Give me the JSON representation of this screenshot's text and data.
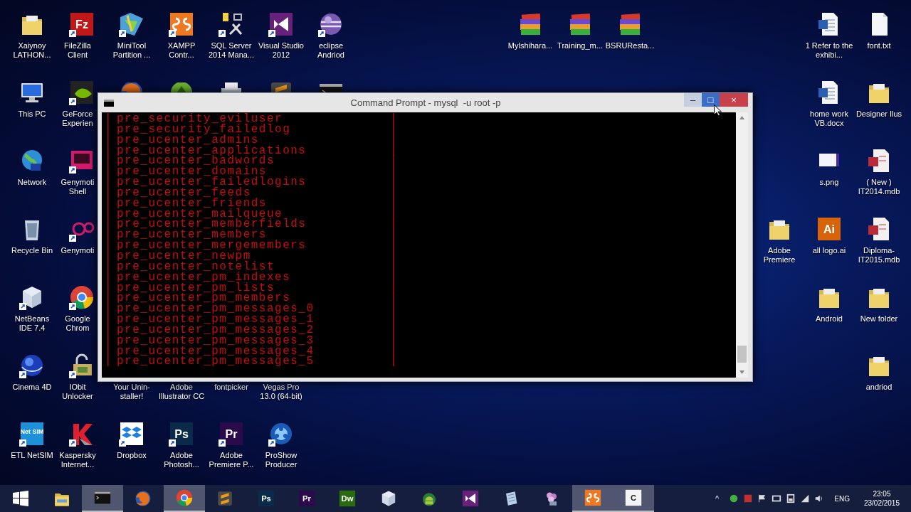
{
  "desktop": {
    "left_columns": [
      {
        "icons": [
          {
            "label": "Xaiynoy LATHON...",
            "kind": "folder",
            "shortcut": false
          },
          {
            "label": "This PC",
            "kind": "pc",
            "shortcut": false
          },
          {
            "label": "Network",
            "kind": "globe",
            "shortcut": false
          },
          {
            "label": "Recycle Bin",
            "kind": "bin",
            "shortcut": false
          },
          {
            "label": "NetBeans IDE 7.4",
            "kind": "cube",
            "shortcut": true
          },
          {
            "label": "Cinema 4D",
            "kind": "sphere",
            "shortcut": true
          },
          {
            "label": "ETL NetSIM",
            "kind": "tile",
            "glyph": "Net SIM",
            "color": "#1e90d8",
            "shortcut": true
          }
        ]
      },
      {
        "icons": [
          {
            "label": "FileZilla Client",
            "kind": "tile",
            "glyph": "Fz",
            "color": "#c01818",
            "shortcut": true
          },
          {
            "label": "GeForce Experien",
            "kind": "nvidia",
            "shortcut": true
          },
          {
            "label": "Genymoti Shell",
            "kind": "geny",
            "shortcut": true
          },
          {
            "label": "Genymoti",
            "kind": "geny2",
            "shortcut": true
          },
          {
            "label": "Google Chrom",
            "kind": "chrome",
            "shortcut": true
          },
          {
            "label": "IObit Unlocker",
            "kind": "lock",
            "shortcut": true
          },
          {
            "label": "Kaspersky Internet...",
            "kind": "kaspersky",
            "shortcut": true
          }
        ]
      }
    ],
    "upper_columns": [
      {
        "icons": [
          {
            "label": "MiniTool Partition ...",
            "kind": "minitool",
            "shortcut": true
          },
          {
            "kind": "firefox"
          }
        ]
      },
      {
        "icons": [
          {
            "label": "XAMPP Contr...",
            "kind": "xampp",
            "shortcut": true
          },
          {
            "kind": "greenball"
          }
        ]
      },
      {
        "icons": [
          {
            "label": "SQL Server 2014 Mana...",
            "kind": "sql",
            "shortcut": true
          },
          {
            "kind": "printer"
          }
        ]
      },
      {
        "icons": [
          {
            "label": "Visual Studio 2012",
            "kind": "vs",
            "shortcut": true
          },
          {
            "kind": "sublime"
          }
        ]
      },
      {
        "icons": [
          {
            "label": "eclipse Andriod",
            "kind": "eclipse",
            "shortcut": true
          },
          {
            "kind": "cmd"
          }
        ]
      }
    ],
    "lower_columns": [
      {
        "icons": [
          {
            "label": "Your Unin-staller!"
          },
          {
            "label": "Dropbox",
            "kind": "dropbox",
            "shortcut": true
          }
        ]
      },
      {
        "icons": [
          {
            "label": "Adobe Illustrator CC"
          },
          {
            "label": "Adobe Photosh...",
            "kind": "tile",
            "glyph": "Ps",
            "color": "#0a2a4a",
            "shortcut": true
          }
        ]
      },
      {
        "icons": [
          {
            "label": "fontpicker"
          },
          {
            "label": "Adobe Premiere P...",
            "kind": "tile",
            "glyph": "Pr",
            "color": "#2a0a4a",
            "shortcut": true
          }
        ]
      },
      {
        "icons": [
          {
            "label": "Vegas Pro 13.0 (64-bit)"
          },
          {
            "label": "ProShow Producer",
            "kind": "proshow",
            "shortcut": true
          }
        ]
      }
    ],
    "middle_columns": [
      {
        "icons": [
          {
            "label": "Mylshihara...",
            "kind": "rar",
            "shortcut": false
          }
        ]
      },
      {
        "icons": [
          {
            "label": "Training_m...",
            "kind": "rar",
            "shortcut": false
          }
        ]
      },
      {
        "icons": [
          {
            "label": "BSRUResta...",
            "kind": "rar",
            "shortcut": false
          }
        ]
      }
    ],
    "right_lone": [
      {
        "icons": [
          {
            "label": "Adobe Premiere",
            "kind": "folder",
            "shortcut": false
          }
        ]
      }
    ],
    "right_columns": [
      {
        "icons": [
          {
            "label": "1 Refer to the exhibi...",
            "kind": "word",
            "shortcut": false
          },
          {
            "label": "home work VB.docx",
            "kind": "word",
            "shortcut": false
          },
          {
            "label": "s.png",
            "kind": "image",
            "shortcut": false
          },
          {
            "label": "all logo.ai",
            "kind": "tile",
            "glyph": "Ai",
            "color": "#d8640a",
            "shortcut": false
          },
          {
            "label": "Android",
            "kind": "folder",
            "shortcut": false
          }
        ]
      },
      {
        "icons": [
          {
            "label": "font.txt",
            "kind": "doc",
            "shortcut": false
          },
          {
            "label": "Designer Ilus",
            "kind": "folder",
            "shortcut": false
          },
          {
            "label": "( New ) IT2014.mdb",
            "kind": "access",
            "shortcut": false
          },
          {
            "label": "Diploma-IT2015.mdb",
            "kind": "access",
            "shortcut": false
          },
          {
            "label": "New folder",
            "kind": "folder",
            "shortcut": false
          },
          {
            "label": "andriod",
            "kind": "folder",
            "shortcut": false
          }
        ]
      }
    ]
  },
  "window": {
    "title": "Command Prompt - mysql  -u root -p",
    "buttons": [
      {
        "kind": "minimize",
        "glyph": "–",
        "hovered": false
      },
      {
        "kind": "maximize",
        "glyph": "□",
        "hovered": true
      },
      {
        "kind": "close",
        "glyph": "×",
        "hovered": false
      }
    ],
    "console_rows": [
      {
        "left": "|",
        "name": "pre_security_eviluser",
        "right": "|"
      },
      {
        "left": "|",
        "name": "pre_security_failedlog",
        "right": "|"
      },
      {
        "left": "|",
        "name": "pre_ucenter_admins",
        "right": "|"
      },
      {
        "left": "|",
        "name": "pre_ucenter_applications",
        "right": "|"
      },
      {
        "left": "|",
        "name": "pre_ucenter_badwords",
        "right": "|"
      },
      {
        "left": "|",
        "name": "pre_ucenter_domains",
        "right": "|"
      },
      {
        "left": "|",
        "name": "pre_ucenter_failedlogins",
        "right": "|"
      },
      {
        "left": "|",
        "name": "pre_ucenter_feeds",
        "right": "|"
      },
      {
        "left": "|",
        "name": "pre_ucenter_friends",
        "right": "|"
      },
      {
        "left": "|",
        "name": "pre_ucenter_mailqueue",
        "right": "|"
      },
      {
        "left": "|",
        "name": "pre_ucenter_memberfields",
        "right": "|"
      },
      {
        "left": "|",
        "name": "pre_ucenter_members",
        "right": "|"
      },
      {
        "left": "|",
        "name": "pre_ucenter_mergemembers",
        "right": "|"
      },
      {
        "left": "|",
        "name": "pre_ucenter_newpm",
        "right": "|"
      },
      {
        "left": "|",
        "name": "pre_ucenter_notelist",
        "right": "|"
      },
      {
        "left": "|",
        "name": "pre_ucenter_pm_indexes",
        "right": "|"
      },
      {
        "left": "|",
        "name": "pre_ucenter_pm_lists",
        "right": "|"
      },
      {
        "left": "|",
        "name": "pre_ucenter_pm_members",
        "right": "|"
      },
      {
        "left": "|",
        "name": "pre_ucenter_pm_messages_0",
        "right": "|"
      },
      {
        "left": "|",
        "name": "pre_ucenter_pm_messages_1",
        "right": "|"
      },
      {
        "left": "|",
        "name": "pre_ucenter_pm_messages_2",
        "right": "|"
      },
      {
        "left": "|",
        "name": "pre_ucenter_pm_messages_3",
        "right": "|"
      },
      {
        "left": "|",
        "name": "pre_ucenter_pm_messages_4",
        "right": "|"
      },
      {
        "left": "|",
        "name": "pre_ucenter_pm_messages_5",
        "right": "|"
      }
    ]
  },
  "taskbar": {
    "items": [
      {
        "kind": "explorer",
        "open": false
      },
      {
        "kind": "cmd",
        "open": true
      },
      {
        "kind": "firefox",
        "open": false
      },
      {
        "kind": "chrome",
        "open": true
      },
      {
        "kind": "sublime",
        "open": false
      },
      {
        "kind": "tile",
        "glyph": "Ps",
        "color": "#0a2a4a",
        "open": false
      },
      {
        "kind": "tile",
        "glyph": "Pr",
        "color": "#2a0a4a",
        "open": false
      },
      {
        "kind": "tile",
        "glyph": "Dw",
        "color": "#2a6a10",
        "open": false
      },
      {
        "kind": "cube",
        "open": false
      },
      {
        "kind": "android",
        "open": false
      },
      {
        "kind": "vs",
        "open": false
      },
      {
        "kind": "notepad",
        "open": false
      },
      {
        "kind": "flower",
        "open": false
      },
      {
        "kind": "xampp",
        "open": true
      },
      {
        "kind": "tile",
        "glyph": "C",
        "color": "#f4f4f4",
        "open": true
      }
    ],
    "tray": {
      "overflow": "^",
      "icons": [
        {
          "kind": "green"
        },
        {
          "kind": "red"
        },
        {
          "kind": "flag"
        },
        {
          "kind": "network"
        },
        {
          "kind": "battery"
        },
        {
          "kind": "signal"
        },
        {
          "kind": "volume"
        }
      ],
      "language": "ENG",
      "time": "23:05",
      "date": "23/02/2015"
    }
  }
}
